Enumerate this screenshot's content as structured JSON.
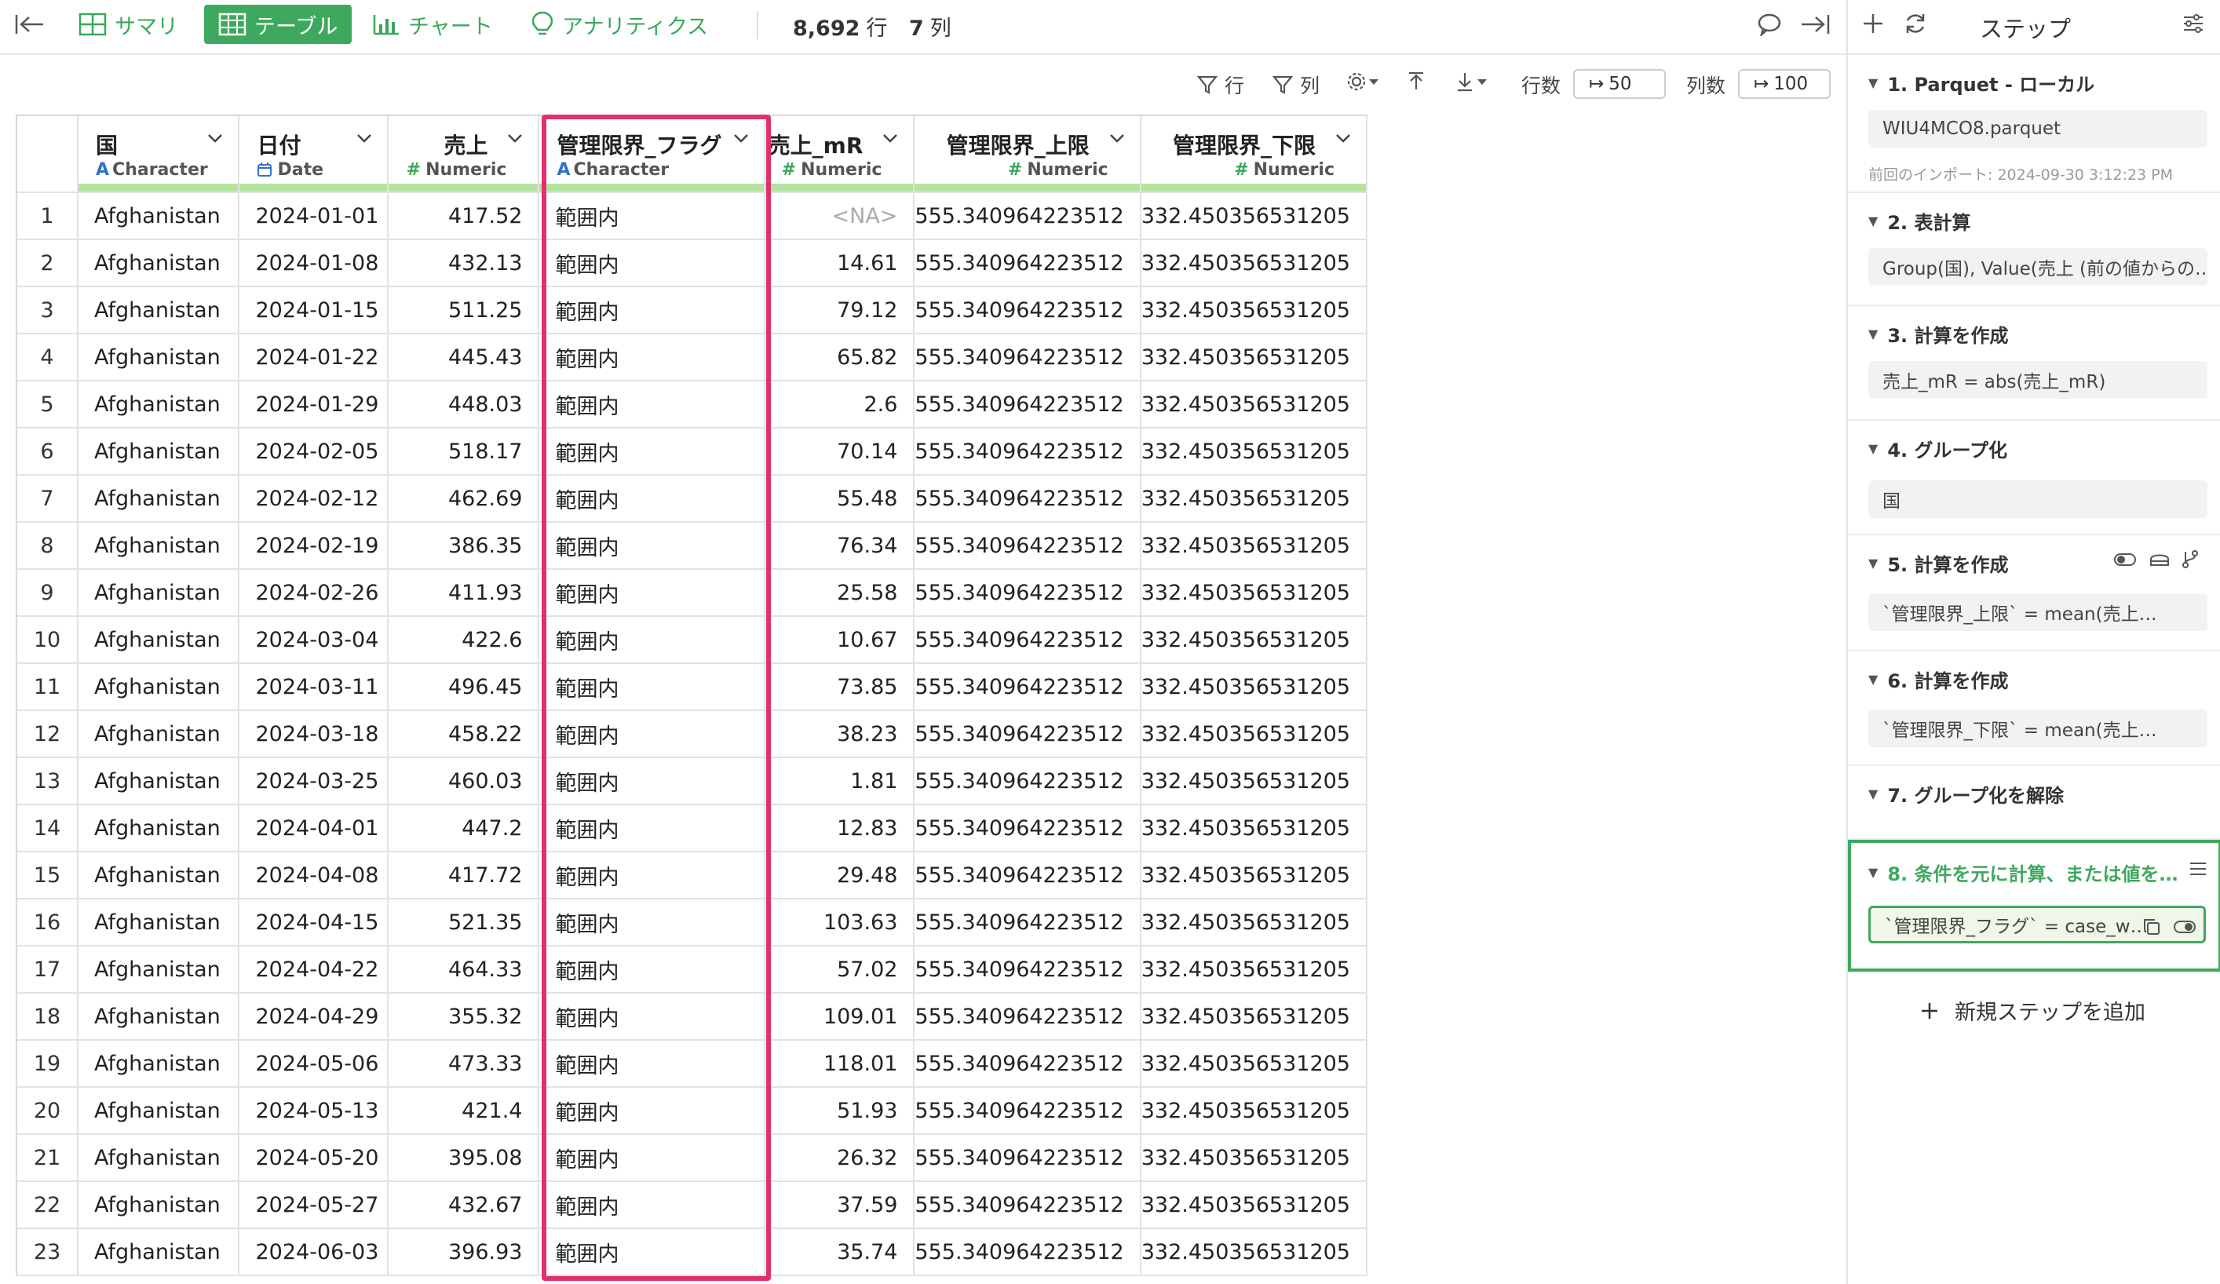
{
  "toolbar": {
    "tab_summary": "サマリ",
    "tab_table": "テーブル",
    "tab_chart": "チャート",
    "tab_analytics": "アナリティクス",
    "row_count": "8,692",
    "row_unit": "行",
    "col_count": "7",
    "col_unit": "列"
  },
  "subbar": {
    "filter_rows": "行",
    "filter_cols": "列",
    "rows_label": "行数",
    "rows_value": "50",
    "cols_label": "列数",
    "cols_value": "100"
  },
  "table": {
    "columns": [
      {
        "name": "国",
        "type": "Character",
        "type_icon": "A"
      },
      {
        "name": "日付",
        "type": "Date",
        "type_icon": "calendar"
      },
      {
        "name": "売上",
        "type": "Numeric",
        "type_icon": "#"
      },
      {
        "name": "管理限界_フラグ",
        "type": "Character",
        "type_icon": "A"
      },
      {
        "name": "売上_mR",
        "type": "Numeric",
        "type_icon": "#"
      },
      {
        "name": "管理限界_上限",
        "type": "Numeric",
        "type_icon": "#"
      },
      {
        "name": "管理限界_下限",
        "type": "Numeric",
        "type_icon": "#"
      }
    ],
    "rows": [
      [
        "1",
        "Afghanistan",
        "2024-01-01",
        "417.52",
        "範囲内",
        "<NA>",
        "555.340964223512",
        "332.450356531205"
      ],
      [
        "2",
        "Afghanistan",
        "2024-01-08",
        "432.13",
        "範囲内",
        "14.61",
        "555.340964223512",
        "332.450356531205"
      ],
      [
        "3",
        "Afghanistan",
        "2024-01-15",
        "511.25",
        "範囲内",
        "79.12",
        "555.340964223512",
        "332.450356531205"
      ],
      [
        "4",
        "Afghanistan",
        "2024-01-22",
        "445.43",
        "範囲内",
        "65.82",
        "555.340964223512",
        "332.450356531205"
      ],
      [
        "5",
        "Afghanistan",
        "2024-01-29",
        "448.03",
        "範囲内",
        "2.6",
        "555.340964223512",
        "332.450356531205"
      ],
      [
        "6",
        "Afghanistan",
        "2024-02-05",
        "518.17",
        "範囲内",
        "70.14",
        "555.340964223512",
        "332.450356531205"
      ],
      [
        "7",
        "Afghanistan",
        "2024-02-12",
        "462.69",
        "範囲内",
        "55.48",
        "555.340964223512",
        "332.450356531205"
      ],
      [
        "8",
        "Afghanistan",
        "2024-02-19",
        "386.35",
        "範囲内",
        "76.34",
        "555.340964223512",
        "332.450356531205"
      ],
      [
        "9",
        "Afghanistan",
        "2024-02-26",
        "411.93",
        "範囲内",
        "25.58",
        "555.340964223512",
        "332.450356531205"
      ],
      [
        "10",
        "Afghanistan",
        "2024-03-04",
        "422.6",
        "範囲内",
        "10.67",
        "555.340964223512",
        "332.450356531205"
      ],
      [
        "11",
        "Afghanistan",
        "2024-03-11",
        "496.45",
        "範囲内",
        "73.85",
        "555.340964223512",
        "332.450356531205"
      ],
      [
        "12",
        "Afghanistan",
        "2024-03-18",
        "458.22",
        "範囲内",
        "38.23",
        "555.340964223512",
        "332.450356531205"
      ],
      [
        "13",
        "Afghanistan",
        "2024-03-25",
        "460.03",
        "範囲内",
        "1.81",
        "555.340964223512",
        "332.450356531205"
      ],
      [
        "14",
        "Afghanistan",
        "2024-04-01",
        "447.2",
        "範囲内",
        "12.83",
        "555.340964223512",
        "332.450356531205"
      ],
      [
        "15",
        "Afghanistan",
        "2024-04-08",
        "417.72",
        "範囲内",
        "29.48",
        "555.340964223512",
        "332.450356531205"
      ],
      [
        "16",
        "Afghanistan",
        "2024-04-15",
        "521.35",
        "範囲内",
        "103.63",
        "555.340964223512",
        "332.450356531205"
      ],
      [
        "17",
        "Afghanistan",
        "2024-04-22",
        "464.33",
        "範囲内",
        "57.02",
        "555.340964223512",
        "332.450356531205"
      ],
      [
        "18",
        "Afghanistan",
        "2024-04-29",
        "355.32",
        "範囲内",
        "109.01",
        "555.340964223512",
        "332.450356531205"
      ],
      [
        "19",
        "Afghanistan",
        "2024-05-06",
        "473.33",
        "範囲内",
        "118.01",
        "555.340964223512",
        "332.450356531205"
      ],
      [
        "20",
        "Afghanistan",
        "2024-05-13",
        "421.4",
        "範囲内",
        "51.93",
        "555.340964223512",
        "332.450356531205"
      ],
      [
        "21",
        "Afghanistan",
        "2024-05-20",
        "395.08",
        "範囲内",
        "26.32",
        "555.340964223512",
        "332.450356531205"
      ],
      [
        "22",
        "Afghanistan",
        "2024-05-27",
        "432.67",
        "範囲内",
        "37.59",
        "555.340964223512",
        "332.450356531205"
      ],
      [
        "23",
        "Afghanistan",
        "2024-06-03",
        "396.93",
        "範囲内",
        "35.74",
        "555.340964223512",
        "332.450356531205"
      ]
    ]
  },
  "panel": {
    "title": "ステップ",
    "steps": [
      {
        "title": "1. Parquet - ローカル",
        "body": "WIU4MCO8.parquet",
        "sub": "前回のインポート: 2024-09-30 3:12:23 PM"
      },
      {
        "title": "2. 表計算",
        "body": "Group(国), Value(売上 (前の値からの…"
      },
      {
        "title": "3. 計算を作成",
        "body": "売上_mR = abs(売上_mR)"
      },
      {
        "title": "4. グループ化",
        "body": "国"
      },
      {
        "title": "5. 計算を作成",
        "body": "`管理限界_上限` = mean(売上…"
      },
      {
        "title": "6. 計算を作成",
        "body": "`管理限界_下限` = mean(売上…"
      },
      {
        "title": "7. グループ化を解除",
        "body": ""
      },
      {
        "title": "8. 条件を元に計算、または値を…",
        "body": "`管理限界_フラグ` = case_w…"
      }
    ],
    "add_step": "新規ステップを追加"
  },
  "colors": {
    "accent_green": "#3fa85f",
    "highlight_red": "#e0326a",
    "type_blue": "#2f73c7"
  }
}
